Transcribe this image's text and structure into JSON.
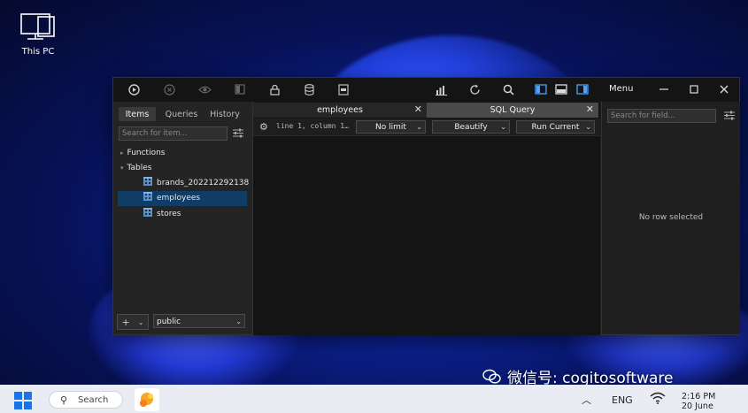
{
  "desktop": {
    "icon_label": "This PC"
  },
  "toolbar": {
    "icons": [
      "circle-play-icon",
      "circle-x-icon",
      "eye-icon",
      "panel-icon",
      "lock-icon",
      "database-icon",
      "sql-file-icon",
      "chart-icon",
      "refresh-icon",
      "search-icon",
      "layout-left-icon",
      "layout-bottom-icon",
      "layout-right-icon"
    ],
    "menu_label": "Menu"
  },
  "left_panel": {
    "tabs": [
      "Items",
      "Queries",
      "History"
    ],
    "search_placeholder": "Search for item...",
    "tree": {
      "functions_label": "Functions",
      "tables_label": "Tables",
      "tables": [
        "brands_202212292138",
        "employees",
        "stores"
      ]
    },
    "add_label": "+",
    "schema_value": "public"
  },
  "editor": {
    "tabs": [
      {
        "label": "employees"
      },
      {
        "label": "SQL Query"
      }
    ],
    "cursor_position": "line 1, column 1…",
    "limit_value": "No limit",
    "beautify_label": "Beautify",
    "run_label": "Run Current"
  },
  "right_panel": {
    "search_placeholder": "Search for field...",
    "empty_message": "No row selected"
  },
  "taskbar": {
    "search_label": "Search",
    "lang": "ENG",
    "time": "2:16 PM",
    "date": "20 June"
  },
  "watermark": {
    "text": "微信号: cogitosoftware"
  },
  "colors": {
    "accent": "#4aa3ff",
    "selection": "#0f3d66",
    "taskbar": "#e9ecf3"
  }
}
